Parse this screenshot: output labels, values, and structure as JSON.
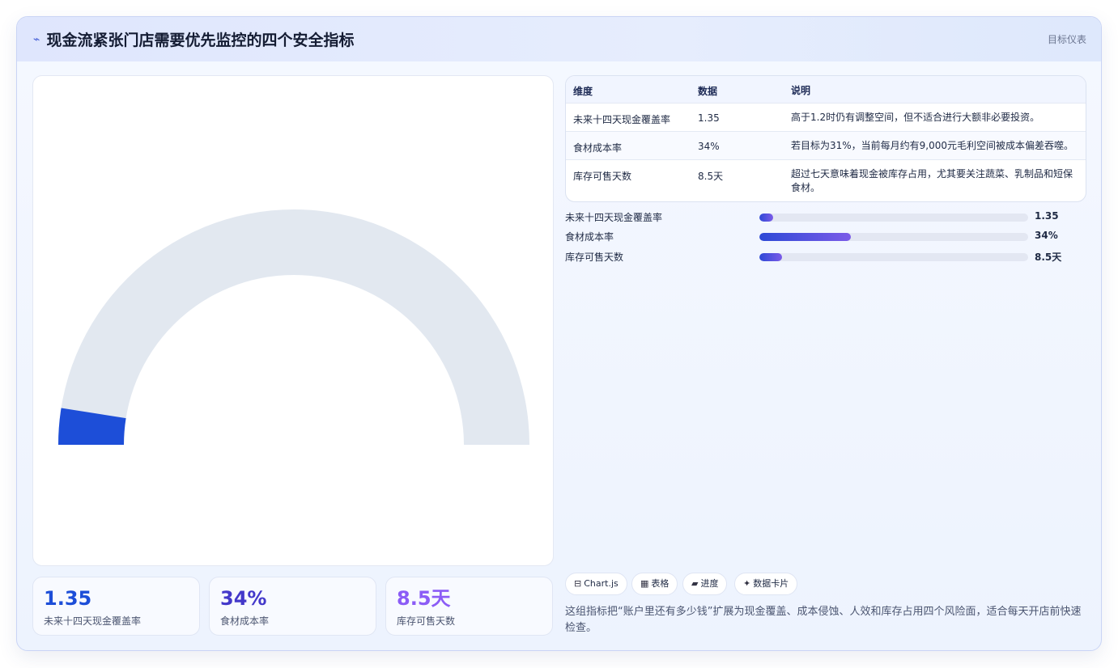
{
  "header": {
    "title": "现金流紧张门店需要优先监控的四个安全指标",
    "tag": "目标仪表",
    "icon": "pulse-icon"
  },
  "gauge": {
    "value": 1.35,
    "max": 100,
    "color_fill": "#1d4ed8",
    "color_track": "#e2e8f0"
  },
  "kpis": [
    {
      "value": "1.35",
      "label": "未来十四天现金覆盖率",
      "color": "#1d4ed8"
    },
    {
      "value": "34%",
      "label": "食材成本率",
      "color": "#4338ca"
    },
    {
      "value": "8.5天",
      "label": "库存可售天数",
      "color": "#8b5cf6"
    }
  ],
  "table": {
    "headers": [
      "维度",
      "数据",
      "说明"
    ],
    "rows": [
      [
        "未来十四天现金覆盖率",
        "1.35",
        "高于1.2时仍有调整空间，但不适合进行大额非必要投资。"
      ],
      [
        "食材成本率",
        "34%",
        "若目标为31%，当前每月约有9,000元毛利空间被成本偏差吞噬。"
      ],
      [
        "库存可售天数",
        "8.5天",
        "超过七天意味着现金被库存占用，尤其要关注蔬菜、乳制品和短保食材。"
      ]
    ]
  },
  "bars": [
    {
      "label": "未来十四天现金覆盖率",
      "value": "1.35",
      "fraction": 0.0135
    },
    {
      "label": "食材成本率",
      "value": "34%",
      "fraction": 0.34
    },
    {
      "label": "库存可售天数",
      "value": "8.5天",
      "fraction": 0.085
    }
  ],
  "chips": [
    {
      "icon": "chart-icon",
      "glyph": "⊟",
      "label": "Chart.js"
    },
    {
      "icon": "table-icon",
      "glyph": "▦",
      "label": "表格"
    },
    {
      "icon": "progress-icon",
      "glyph": "▰",
      "label": "进度"
    },
    {
      "icon": "sparkle-icon",
      "glyph": "✦",
      "label": "数据卡片"
    }
  ],
  "note": "这组指标把“账户里还有多少钱”扩展为现金覆盖、成本侵蚀、人效和库存占用四个风险面，适合每天开店前快速检查。"
}
